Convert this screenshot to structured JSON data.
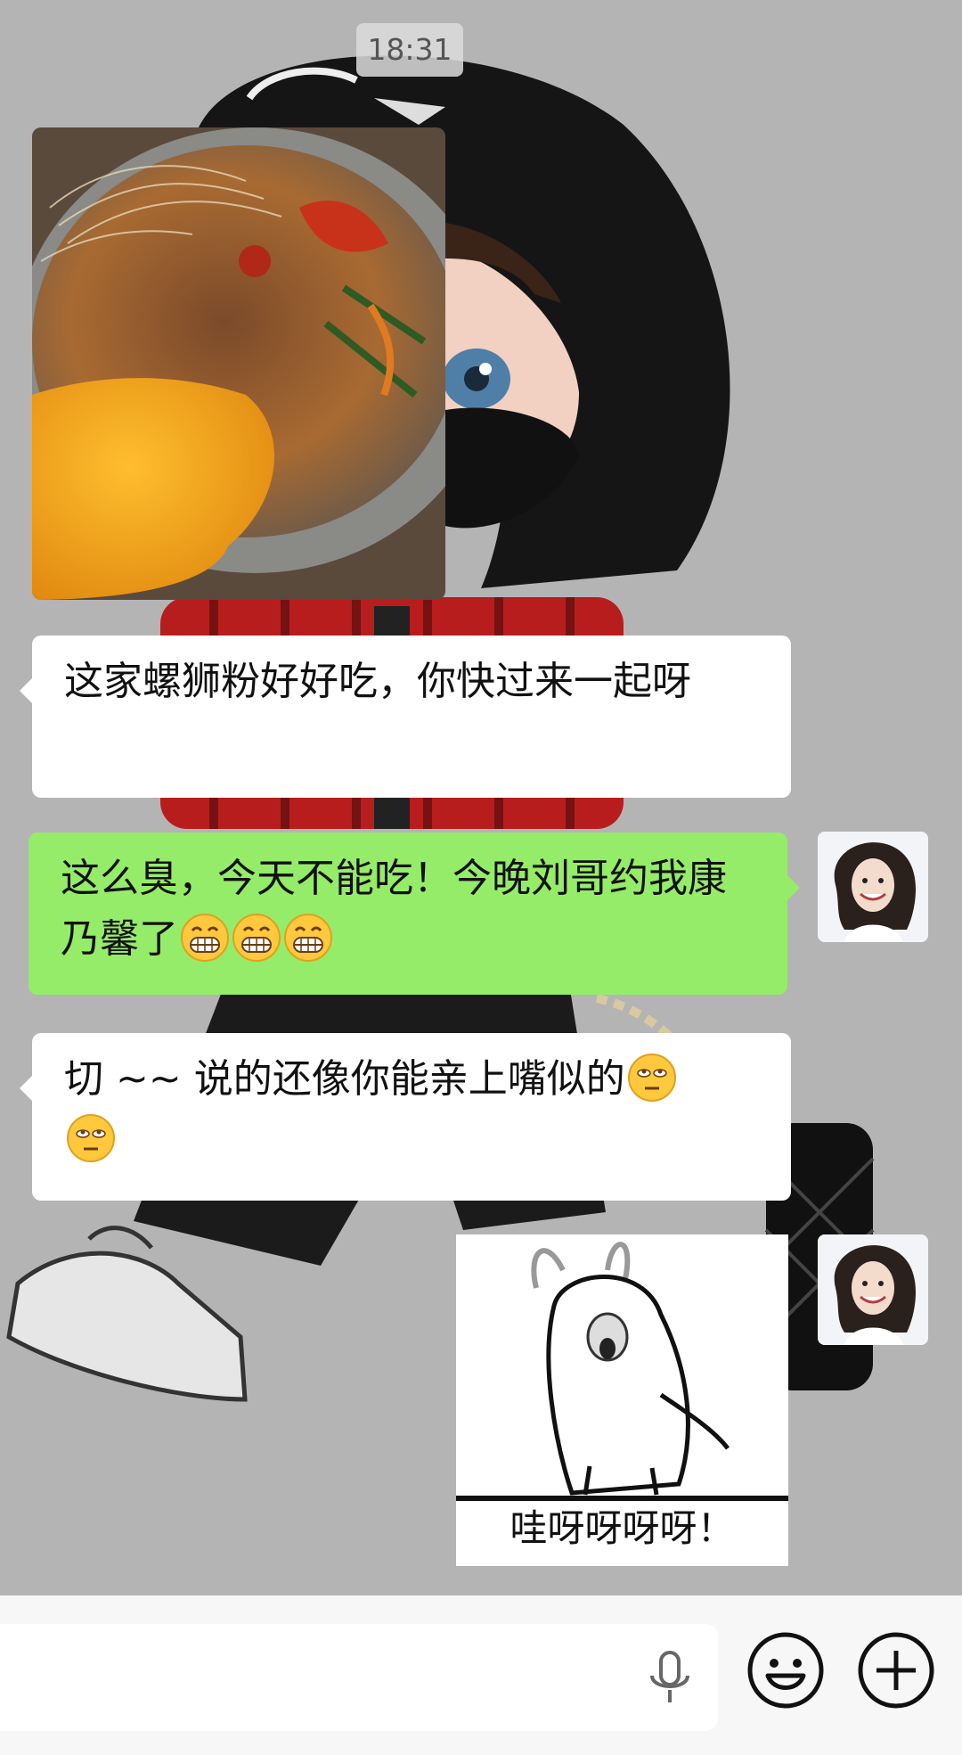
{
  "header": {
    "time": "18:31"
  },
  "messages": [
    {
      "id": "m1",
      "side": "left",
      "type": "image",
      "label": "photo-noodle-soup"
    },
    {
      "id": "m2",
      "side": "left",
      "type": "text",
      "text": "这家螺狮粉好好吃，你快过来一起呀"
    },
    {
      "id": "m3",
      "side": "right",
      "type": "text",
      "text": "这么臭，今天不能吃！今晚刘哥约我康乃馨了",
      "emojis": [
        "grin-icon",
        "grin-icon",
        "grin-icon"
      ]
    },
    {
      "id": "m4",
      "side": "left",
      "type": "text",
      "text": "切 ~~ 说的还像你能亲上嘴似的",
      "emojis": [
        "eye-roll-icon",
        "eye-roll-icon"
      ]
    },
    {
      "id": "m5",
      "side": "right",
      "type": "sticker",
      "caption": "哇呀呀呀呀！"
    }
  ],
  "input_bar": {
    "value": "",
    "icons": [
      "microphone-icon",
      "emoji-face-icon",
      "plus-circle-icon"
    ]
  },
  "colors": {
    "background": "#b4b4b4",
    "incoming_bubble": "#ffffff",
    "outgoing_bubble": "#95ec69",
    "input_bar": "#f7f7f7"
  }
}
